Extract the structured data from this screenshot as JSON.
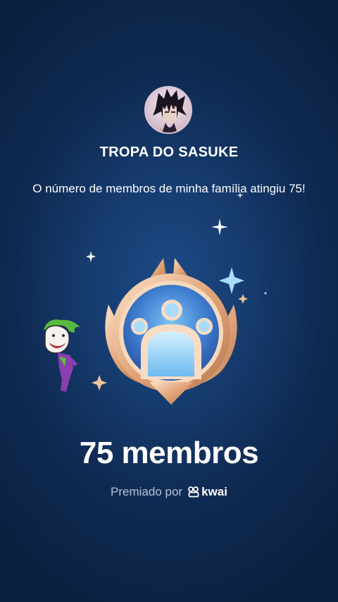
{
  "group": {
    "name": "TROPA DO SASUKE",
    "avatar_icon": "group-avatar"
  },
  "message": {
    "text": "O número de membros de minha família atingiu 75!"
  },
  "badge": {
    "icon": "family-members-badge-icon"
  },
  "milestone": {
    "count_label": "75 membros"
  },
  "award": {
    "prefix": "Premiado por",
    "brand": "kwai",
    "brand_icon": "kwai-logo-icon"
  },
  "sticker": {
    "icon": "joker-sticker-icon"
  },
  "colors": {
    "background": "#163b6e",
    "badge_gold": "#e8b98e",
    "badge_blue": "#6fb4ea",
    "text_secondary": "#b7c3d6"
  }
}
